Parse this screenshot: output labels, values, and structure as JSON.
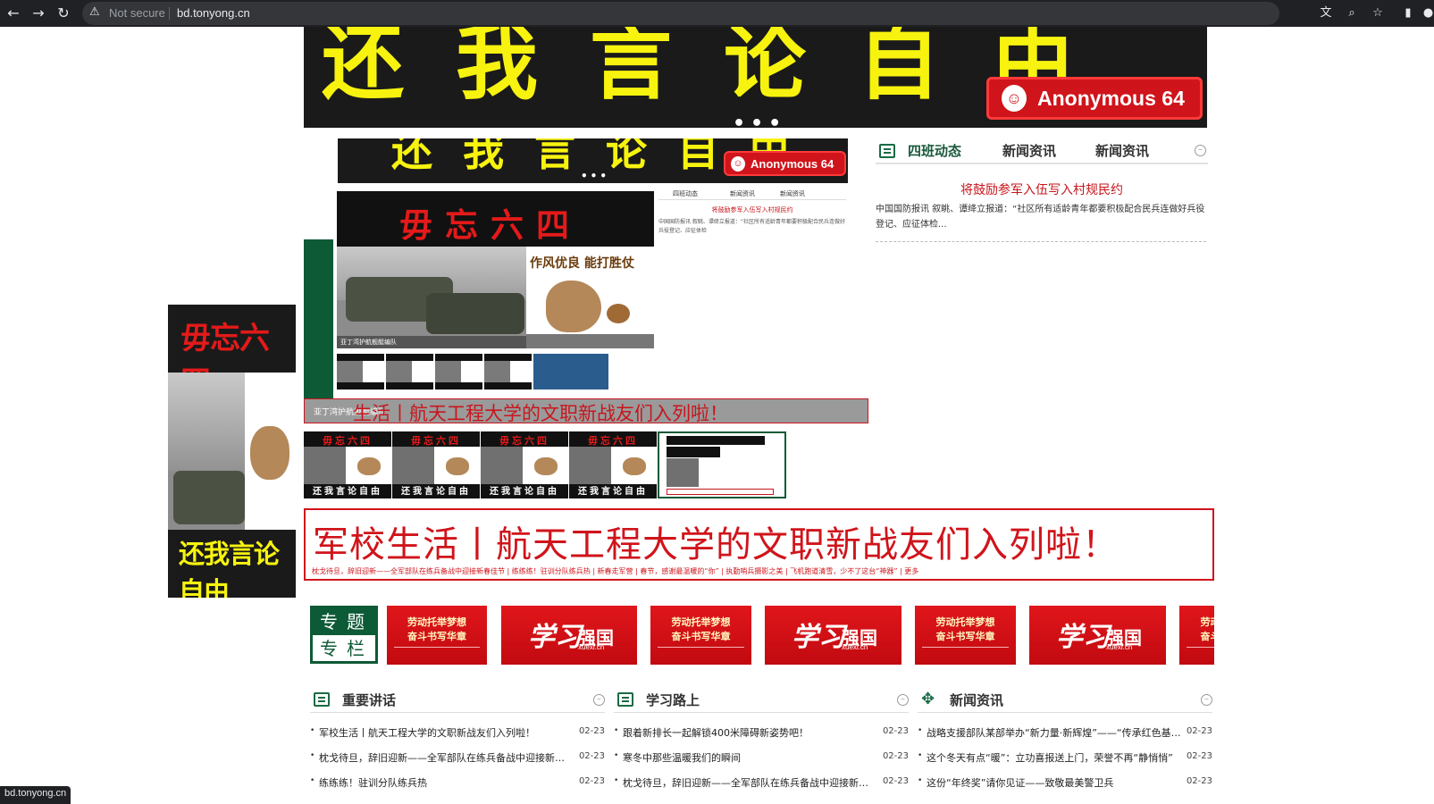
{
  "browser": {
    "security": "Not secure",
    "url": "bd.tonyong.cn",
    "status_url": "bd.tonyong.cn"
  },
  "banner": {
    "title": "还我言论自由",
    "badge": "Anonymous 64",
    "dots": "•••"
  },
  "news_panel": {
    "tabs": [
      "四班动态",
      "新闻资讯",
      "新闻资讯"
    ],
    "headline": "将鼓励参军入伍写入村规民约",
    "summary": "中国国防报讯 叙眺、谭绛立报道：“社区所有适龄青年都要积极配合民兵连做好兵役登记、应征体检..."
  },
  "mini_page": {
    "poster_title": "毋忘六四",
    "cartoon_title": "作风优良 能打胜仗",
    "photo_caption": "亚丁湾护航舰艇编队",
    "tabs": [
      "四班动态",
      "新闻资讯",
      "新闻资讯"
    ],
    "headline": "将鼓励参军入伍写入村规民约",
    "summary": "中国国防报讯 叙眺、谭绛立报道：“社区所有适龄青年都要积极配合民兵连做好兵役登记、应征体检"
  },
  "green_caption": {
    "small": "亚丁湾护航舰艇编队",
    "big": "生活丨航天工程大学的文职新战友们入列啦！"
  },
  "poster": {
    "top": "毋忘六四",
    "bottom": "还我言论自由"
  },
  "filmstrip": {
    "title": "毋忘六四",
    "caption": "还我言论自由"
  },
  "headline": {
    "title": "军校生活丨航天工程大学的文职新战友们入列啦！",
    "subs": "枕戈待旦，辞旧迎新——全军部队在练兵备战中迎接新春佳节 | 练练练！驻训分队练兵热 | 新春走军营 | 春节，感谢最温暖的“你” | 执勤哨兵摄影之美 | 飞机跑道清雪，少不了这台“神器” | 更多"
  },
  "topics": {
    "label_top": "专题",
    "label_bottom": "专栏",
    "card_a_line1": "劳动托举梦想",
    "card_a_line2": "奋斗书写华章",
    "card_b_brand": "学习",
    "card_b_name": "强国",
    "card_b_site": "xuexi.cn"
  },
  "columns": [
    {
      "title": "重要讲话",
      "items": [
        {
          "text": "军校生活丨航天工程大学的文职新战友们入列啦！",
          "date": "02-23"
        },
        {
          "text": "枕戈待旦，辞旧迎新——全军部队在练兵备战中迎接新春佳节",
          "date": "02-23"
        },
        {
          "text": "练练练！驻训分队练兵热",
          "date": "02-23"
        }
      ]
    },
    {
      "title": "学习路上",
      "items": [
        {
          "text": "跟着新排长一起解锁400米障碍新姿势吧！",
          "date": "02-23"
        },
        {
          "text": "寒冬中那些温暖我们的瞬间",
          "date": "02-23"
        },
        {
          "text": "枕戈待旦，辞旧迎新——全军部队在练兵备战中迎接新春佳节",
          "date": "02-23"
        }
      ]
    },
    {
      "title": "新闻资讯",
      "items": [
        {
          "text": "战略支援部队某部举办“新力量·新辉煌”——“传承红色基因”",
          "date": "02-23"
        },
        {
          "text": "这个冬天有点“暖”：立功喜报送上门，荣誉不再“静悄悄”",
          "date": "02-23"
        },
        {
          "text": "这份“年终奖”请你见证——致敬最美警卫兵",
          "date": "02-23"
        }
      ]
    }
  ]
}
